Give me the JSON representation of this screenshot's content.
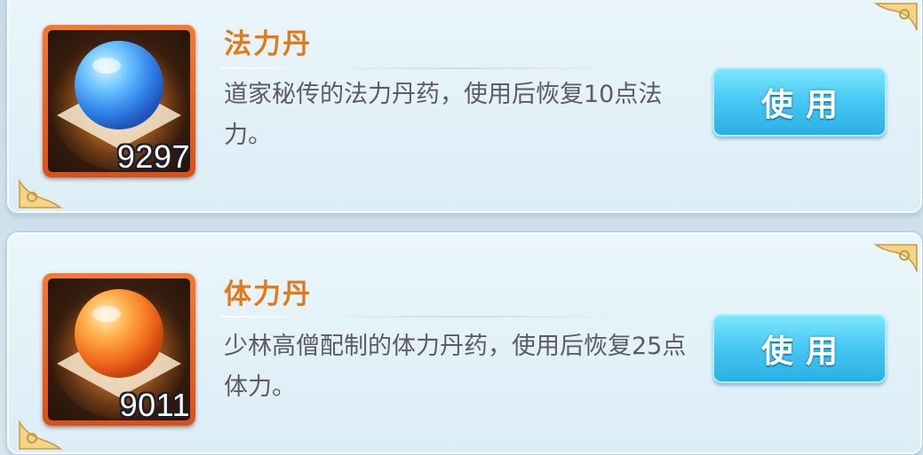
{
  "items": [
    {
      "name": "法力丹",
      "count": "9297",
      "description": "道家秘传的法力丹药，使用后恢复10点法力。",
      "button_label": "使用",
      "orb_color": "#4fb6ff"
    },
    {
      "name": "体力丹",
      "count": "9011",
      "description": "少林高僧配制的体力丹药，使用后恢复25点体力。",
      "button_label": "使用",
      "orb_color": "#ff8a2a"
    }
  ],
  "colors": {
    "title": "#e07a1c",
    "description": "#5e5a62",
    "button": "#46c7f2",
    "frame": "#e8622a"
  }
}
